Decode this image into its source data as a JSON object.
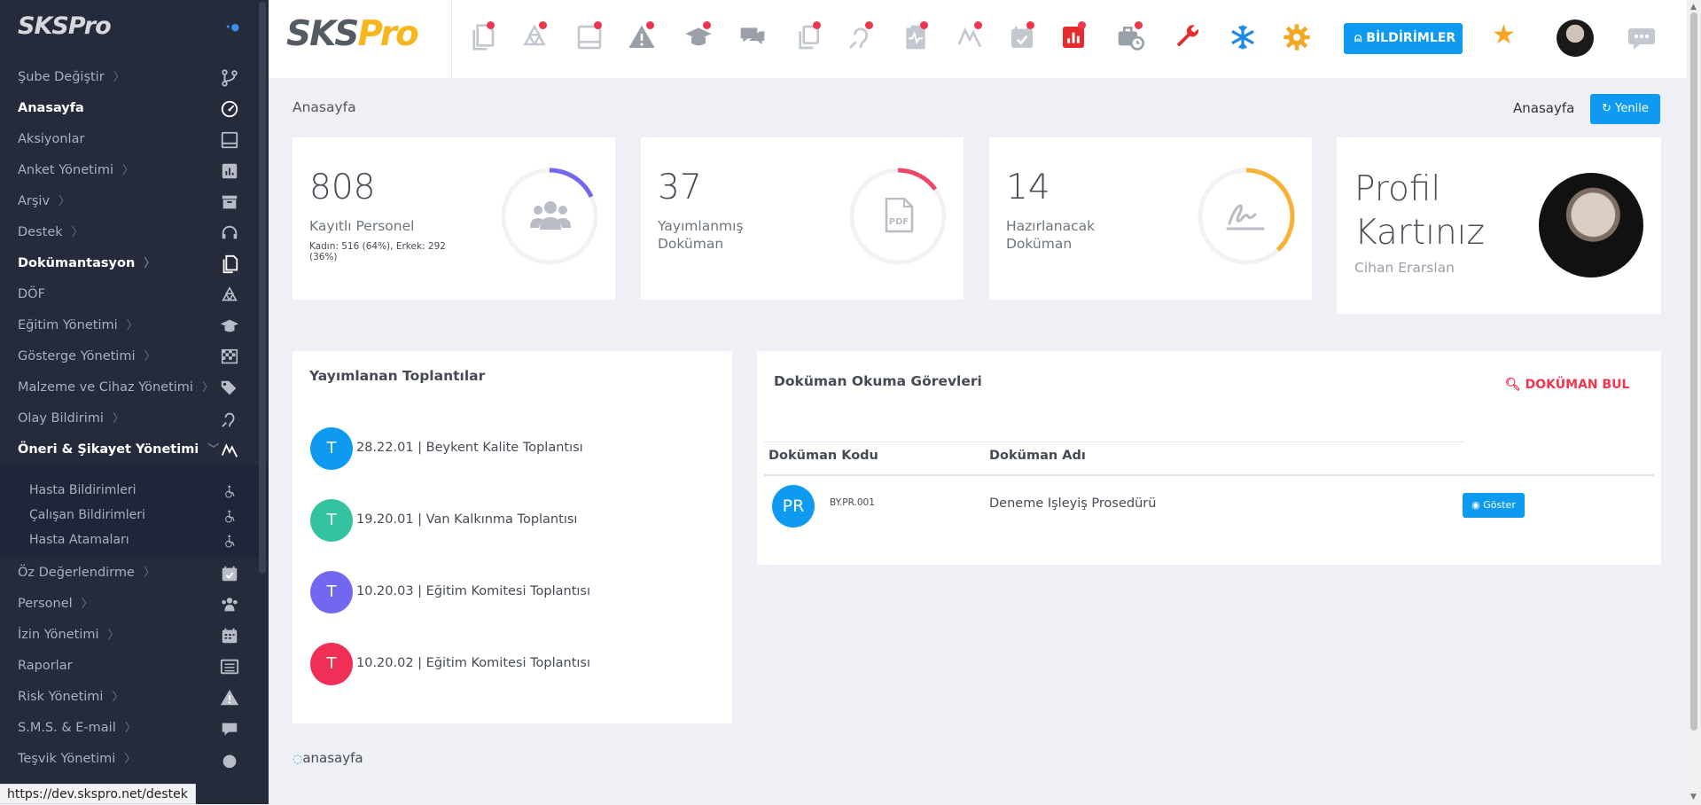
{
  "sidebar": {
    "brand": "SKSPro",
    "toggle_glyph": "•",
    "items": [
      {
        "label": "Şube Değiştir",
        "chevron": true,
        "icon": "branch-icon",
        "active": false
      },
      {
        "label": "Anasayfa",
        "chevron": false,
        "icon": "gauge-icon",
        "active": true
      },
      {
        "label": "Aksiyonlar",
        "chevron": false,
        "icon": "tablet-icon",
        "active": false
      },
      {
        "label": "Anket Yönetimi",
        "chevron": true,
        "icon": "chart-box-icon",
        "active": false
      },
      {
        "label": "Arşiv",
        "chevron": true,
        "icon": "archive-icon",
        "active": false
      },
      {
        "label": "Destek",
        "chevron": true,
        "icon": "headset-icon",
        "active": false
      },
      {
        "label": "Dokümantasyon",
        "chevron": true,
        "icon": "documents-icon",
        "active": true
      },
      {
        "label": "DÖF",
        "chevron": false,
        "icon": "recycle-icon",
        "active": false
      },
      {
        "label": "Eğitim Yönetimi",
        "chevron": true,
        "icon": "graduation-cap-icon",
        "active": false
      },
      {
        "label": "Gösterge Yönetimi",
        "chevron": true,
        "icon": "checkered-flag-icon",
        "active": false
      },
      {
        "label": "Malzeme ve Cihaz Yönetimi",
        "chevron": true,
        "icon": "tags-icon",
        "active": false
      },
      {
        "label": "Olay Bildirimi",
        "chevron": true,
        "icon": "hearing-icon",
        "active": false
      },
      {
        "label": "Öneri & Şikayet Yönetimi",
        "chevron": "down",
        "icon": "signature-icon",
        "active": true
      }
    ],
    "subitems": [
      {
        "label": "Hasta Bildirimleri",
        "icon": "wheelchair-icon"
      },
      {
        "label": "Çalışan Bildirimleri",
        "icon": "wheelchair-icon"
      },
      {
        "label": "Hasta Atamaları",
        "icon": "wheelchair-icon"
      }
    ],
    "items_after": [
      {
        "label": "Öz Değerlendirme",
        "chevron": true,
        "icon": "calendar-check-icon"
      },
      {
        "label": "Personel",
        "chevron": true,
        "icon": "users-icon"
      },
      {
        "label": "İzin Yönetimi",
        "chevron": true,
        "icon": "calendar-icon"
      },
      {
        "label": "Raporlar",
        "chevron": false,
        "icon": "list-icon"
      },
      {
        "label": "Risk Yönetimi",
        "chevron": true,
        "icon": "warning-icon"
      },
      {
        "label": "S.M.S. & E-mail",
        "chevron": true,
        "icon": "sms-icon"
      },
      {
        "label": "Teşvik Yönetimi",
        "chevron": true,
        "icon": "circle-icon"
      }
    ]
  },
  "status_url": "https://dev.skspro.net/destek",
  "topbar": {
    "logo_sks": "SKS",
    "logo_pro": "Pro",
    "icons": [
      {
        "name": "documents-icon",
        "color": "#c3c7cf",
        "dot": true
      },
      {
        "name": "recycle-icon",
        "color": "#c3c7cf",
        "dot": true
      },
      {
        "name": "tablet-icon",
        "color": "#c3c7cf",
        "dot": true
      },
      {
        "name": "warning-icon",
        "color": "#9aa0a8",
        "dot": true
      },
      {
        "name": "graduation-cap-icon",
        "color": "#9aa0a8",
        "dot": true
      },
      {
        "name": "comments-icon",
        "color": "#9aa0a8",
        "dot": false
      },
      {
        "name": "copy-icon",
        "color": "#c3c7cf",
        "dot": true
      },
      {
        "name": "hearing-icon",
        "color": "#c3c7cf",
        "dot": true
      },
      {
        "name": "clipboard-pulse-icon",
        "color": "#c3c7cf",
        "dot": true
      },
      {
        "name": "signature-icon",
        "color": "#c3c7cf",
        "dot": true
      },
      {
        "name": "calendar-check-icon",
        "color": "#c3c7cf",
        "dot": true
      },
      {
        "name": "chart-report-icon",
        "color": "#e52b2b",
        "dot": true
      },
      {
        "name": "briefcase-clock-icon",
        "color": "#9aa0a8",
        "dot": true
      },
      {
        "name": "wrench-icon",
        "color": "#e52b2b",
        "dot": false
      },
      {
        "name": "snowflake-icon",
        "color": "#1e88e5",
        "dot": false
      },
      {
        "name": "gear-icon",
        "color": "#f5a623",
        "dot": false
      }
    ],
    "notifications_label": "BİLDİRİMLER",
    "accent": "#0d9af0",
    "dot_color": "#f0354f"
  },
  "page": {
    "title": "Anasayfa",
    "breadcrumb": "Anasayfa",
    "refresh_label": "Yenile"
  },
  "stats": [
    {
      "value": "808",
      "label": "Kayıtlı Personel",
      "sub": "Kadın: 516 (64%), Erkek: 292 (36%)",
      "progress": 0.18,
      "color": "#7367f0",
      "icon": "users-icon"
    },
    {
      "value": "37",
      "label": "Yayımlanmış Doküman",
      "progress": 0.15,
      "color": "#ef4866",
      "icon": "pdf-icon"
    },
    {
      "value": "14",
      "label": "Hazırlanacak Doküman",
      "progress": 0.38,
      "color": "#f7b133",
      "icon": "signature-icon"
    }
  ],
  "profile": {
    "title": "Profil Kartınız",
    "name": "Cihan Erarslan"
  },
  "meetings": {
    "title": "Yayımlanan Toplantılar",
    "items": [
      {
        "initial": "T",
        "text": "28.22.01 | Beykent Kalite Toplantısı",
        "color": "#0d9af0"
      },
      {
        "initial": "T",
        "text": "19.20.01 | Van Kalkınma Toplantısı",
        "color": "#34c3a0"
      },
      {
        "initial": "T",
        "text": "10.20.03 | Eğitim Komitesi Toplantısı",
        "color": "#7367f0"
      },
      {
        "initial": "T",
        "text": "10.20.02 | Eğitim Komitesi Toplantısı",
        "color": "#ef2f55"
      }
    ]
  },
  "doc_tasks": {
    "title": "Doküman Okuma Görevleri",
    "find_label": "DOKÜMAN BUL",
    "col_code": "Doküman Kodu",
    "col_name": "Doküman Adı",
    "rows": [
      {
        "initials": "PR",
        "code": "BY.PR.001",
        "name": "Deneme Işleyiş Prosedürü",
        "action": "Göster"
      }
    ]
  },
  "footer": {
    "link": "anasayfa"
  }
}
